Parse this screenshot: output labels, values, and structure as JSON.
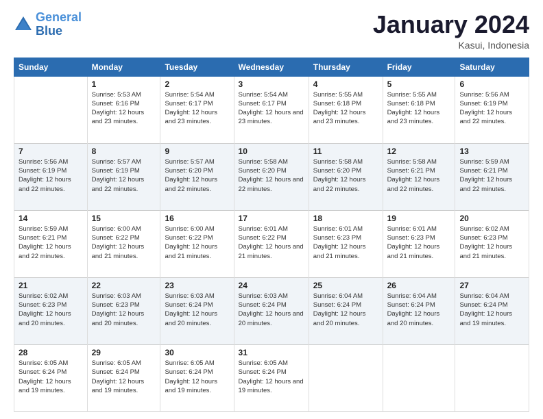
{
  "logo": {
    "line1": "General",
    "line2": "Blue"
  },
  "title": "January 2024",
  "subtitle": "Kasui, Indonesia",
  "header_days": [
    "Sunday",
    "Monday",
    "Tuesday",
    "Wednesday",
    "Thursday",
    "Friday",
    "Saturday"
  ],
  "weeks": [
    [
      {
        "day": "",
        "sunrise": "",
        "sunset": "",
        "daylight": ""
      },
      {
        "day": "1",
        "sunrise": "Sunrise: 5:53 AM",
        "sunset": "Sunset: 6:16 PM",
        "daylight": "Daylight: 12 hours and 23 minutes."
      },
      {
        "day": "2",
        "sunrise": "Sunrise: 5:54 AM",
        "sunset": "Sunset: 6:17 PM",
        "daylight": "Daylight: 12 hours and 23 minutes."
      },
      {
        "day": "3",
        "sunrise": "Sunrise: 5:54 AM",
        "sunset": "Sunset: 6:17 PM",
        "daylight": "Daylight: 12 hours and 23 minutes."
      },
      {
        "day": "4",
        "sunrise": "Sunrise: 5:55 AM",
        "sunset": "Sunset: 6:18 PM",
        "daylight": "Daylight: 12 hours and 23 minutes."
      },
      {
        "day": "5",
        "sunrise": "Sunrise: 5:55 AM",
        "sunset": "Sunset: 6:18 PM",
        "daylight": "Daylight: 12 hours and 23 minutes."
      },
      {
        "day": "6",
        "sunrise": "Sunrise: 5:56 AM",
        "sunset": "Sunset: 6:19 PM",
        "daylight": "Daylight: 12 hours and 22 minutes."
      }
    ],
    [
      {
        "day": "7",
        "sunrise": "Sunrise: 5:56 AM",
        "sunset": "Sunset: 6:19 PM",
        "daylight": "Daylight: 12 hours and 22 minutes."
      },
      {
        "day": "8",
        "sunrise": "Sunrise: 5:57 AM",
        "sunset": "Sunset: 6:19 PM",
        "daylight": "Daylight: 12 hours and 22 minutes."
      },
      {
        "day": "9",
        "sunrise": "Sunrise: 5:57 AM",
        "sunset": "Sunset: 6:20 PM",
        "daylight": "Daylight: 12 hours and 22 minutes."
      },
      {
        "day": "10",
        "sunrise": "Sunrise: 5:58 AM",
        "sunset": "Sunset: 6:20 PM",
        "daylight": "Daylight: 12 hours and 22 minutes."
      },
      {
        "day": "11",
        "sunrise": "Sunrise: 5:58 AM",
        "sunset": "Sunset: 6:20 PM",
        "daylight": "Daylight: 12 hours and 22 minutes."
      },
      {
        "day": "12",
        "sunrise": "Sunrise: 5:58 AM",
        "sunset": "Sunset: 6:21 PM",
        "daylight": "Daylight: 12 hours and 22 minutes."
      },
      {
        "day": "13",
        "sunrise": "Sunrise: 5:59 AM",
        "sunset": "Sunset: 6:21 PM",
        "daylight": "Daylight: 12 hours and 22 minutes."
      }
    ],
    [
      {
        "day": "14",
        "sunrise": "Sunrise: 5:59 AM",
        "sunset": "Sunset: 6:21 PM",
        "daylight": "Daylight: 12 hours and 22 minutes."
      },
      {
        "day": "15",
        "sunrise": "Sunrise: 6:00 AM",
        "sunset": "Sunset: 6:22 PM",
        "daylight": "Daylight: 12 hours and 21 minutes."
      },
      {
        "day": "16",
        "sunrise": "Sunrise: 6:00 AM",
        "sunset": "Sunset: 6:22 PM",
        "daylight": "Daylight: 12 hours and 21 minutes."
      },
      {
        "day": "17",
        "sunrise": "Sunrise: 6:01 AM",
        "sunset": "Sunset: 6:22 PM",
        "daylight": "Daylight: 12 hours and 21 minutes."
      },
      {
        "day": "18",
        "sunrise": "Sunrise: 6:01 AM",
        "sunset": "Sunset: 6:23 PM",
        "daylight": "Daylight: 12 hours and 21 minutes."
      },
      {
        "day": "19",
        "sunrise": "Sunrise: 6:01 AM",
        "sunset": "Sunset: 6:23 PM",
        "daylight": "Daylight: 12 hours and 21 minutes."
      },
      {
        "day": "20",
        "sunrise": "Sunrise: 6:02 AM",
        "sunset": "Sunset: 6:23 PM",
        "daylight": "Daylight: 12 hours and 21 minutes."
      }
    ],
    [
      {
        "day": "21",
        "sunrise": "Sunrise: 6:02 AM",
        "sunset": "Sunset: 6:23 PM",
        "daylight": "Daylight: 12 hours and 20 minutes."
      },
      {
        "day": "22",
        "sunrise": "Sunrise: 6:03 AM",
        "sunset": "Sunset: 6:23 PM",
        "daylight": "Daylight: 12 hours and 20 minutes."
      },
      {
        "day": "23",
        "sunrise": "Sunrise: 6:03 AM",
        "sunset": "Sunset: 6:24 PM",
        "daylight": "Daylight: 12 hours and 20 minutes."
      },
      {
        "day": "24",
        "sunrise": "Sunrise: 6:03 AM",
        "sunset": "Sunset: 6:24 PM",
        "daylight": "Daylight: 12 hours and 20 minutes."
      },
      {
        "day": "25",
        "sunrise": "Sunrise: 6:04 AM",
        "sunset": "Sunset: 6:24 PM",
        "daylight": "Daylight: 12 hours and 20 minutes."
      },
      {
        "day": "26",
        "sunrise": "Sunrise: 6:04 AM",
        "sunset": "Sunset: 6:24 PM",
        "daylight": "Daylight: 12 hours and 20 minutes."
      },
      {
        "day": "27",
        "sunrise": "Sunrise: 6:04 AM",
        "sunset": "Sunset: 6:24 PM",
        "daylight": "Daylight: 12 hours and 19 minutes."
      }
    ],
    [
      {
        "day": "28",
        "sunrise": "Sunrise: 6:05 AM",
        "sunset": "Sunset: 6:24 PM",
        "daylight": "Daylight: 12 hours and 19 minutes."
      },
      {
        "day": "29",
        "sunrise": "Sunrise: 6:05 AM",
        "sunset": "Sunset: 6:24 PM",
        "daylight": "Daylight: 12 hours and 19 minutes."
      },
      {
        "day": "30",
        "sunrise": "Sunrise: 6:05 AM",
        "sunset": "Sunset: 6:24 PM",
        "daylight": "Daylight: 12 hours and 19 minutes."
      },
      {
        "day": "31",
        "sunrise": "Sunrise: 6:05 AM",
        "sunset": "Sunset: 6:24 PM",
        "daylight": "Daylight: 12 hours and 19 minutes."
      },
      {
        "day": "",
        "sunrise": "",
        "sunset": "",
        "daylight": ""
      },
      {
        "day": "",
        "sunrise": "",
        "sunset": "",
        "daylight": ""
      },
      {
        "day": "",
        "sunrise": "",
        "sunset": "",
        "daylight": ""
      }
    ]
  ]
}
